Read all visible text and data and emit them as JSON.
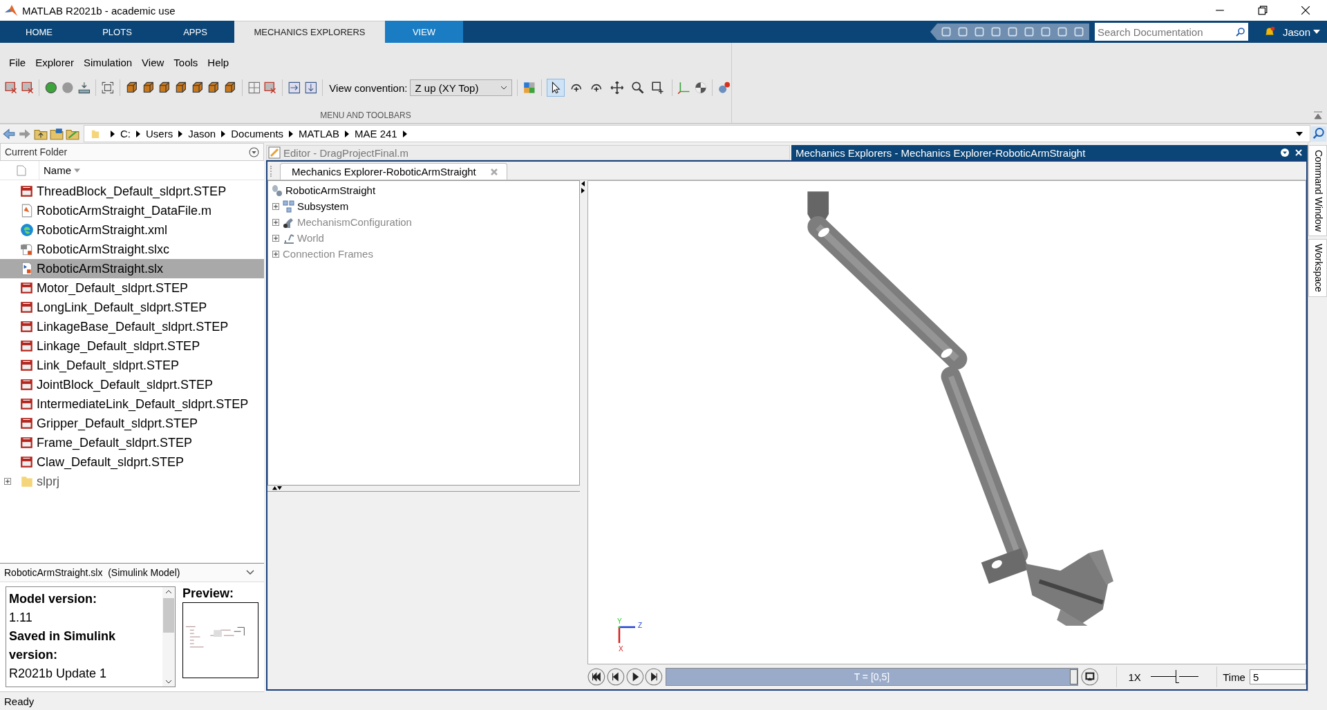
{
  "window": {
    "title": "MATLAB R2021b - academic use"
  },
  "ribbon_tabs": [
    {
      "label": "HOME",
      "selected": false,
      "kind": "standard"
    },
    {
      "label": "PLOTS",
      "selected": false,
      "kind": "standard"
    },
    {
      "label": "APPS",
      "selected": false,
      "kind": "standard"
    },
    {
      "label": "MECHANICS EXPLORERS",
      "selected": true,
      "kind": "standard"
    },
    {
      "label": "VIEW",
      "selected": false,
      "kind": "contextual"
    }
  ],
  "search": {
    "placeholder": "Search Documentation"
  },
  "user": "Jason",
  "menu": [
    "File",
    "Explorer",
    "Simulation",
    "View",
    "Tools",
    "Help"
  ],
  "view_convention": {
    "label": "View convention:",
    "value": "Z up (XY Top)"
  },
  "view_tools": [
    {
      "kind": "pointer",
      "selected": true
    },
    {
      "kind": "rotate",
      "selected": false
    },
    {
      "kind": "roll",
      "selected": false
    },
    {
      "kind": "pan",
      "selected": false
    },
    {
      "kind": "zoom",
      "selected": false
    },
    {
      "kind": "zoom-box",
      "selected": false
    }
  ],
  "toolstrip_section": "MENU AND TOOLBARS",
  "address": [
    "C:",
    "Users",
    "Jason",
    "Documents",
    "MATLAB",
    "MAE 241"
  ],
  "current_folder": {
    "title": "Current Folder",
    "column": "Name",
    "files": [
      {
        "name": "ThreadBlock_Default_sldprt.STEP",
        "kind": "step",
        "selected": false
      },
      {
        "name": "RoboticArmStraight_DataFile.m",
        "kind": "m",
        "selected": false
      },
      {
        "name": "RoboticArmStraight.xml",
        "kind": "xml",
        "selected": false
      },
      {
        "name": "RoboticArmStraight.slxc",
        "kind": "slxc",
        "selected": false
      },
      {
        "name": "RoboticArmStraight.slx",
        "kind": "slx",
        "selected": true
      },
      {
        "name": "Motor_Default_sldprt.STEP",
        "kind": "step",
        "selected": false
      },
      {
        "name": "LongLink_Default_sldprt.STEP",
        "kind": "step",
        "selected": false
      },
      {
        "name": "LinkageBase_Default_sldprt.STEP",
        "kind": "step",
        "selected": false
      },
      {
        "name": "Linkage_Default_sldprt.STEP",
        "kind": "step",
        "selected": false
      },
      {
        "name": "Link_Default_sldprt.STEP",
        "kind": "step",
        "selected": false
      },
      {
        "name": "JointBlock_Default_sldprt.STEP",
        "kind": "step",
        "selected": false
      },
      {
        "name": "IntermediateLink_Default_sldprt.STEP",
        "kind": "step",
        "selected": false
      },
      {
        "name": "Gripper_Default_sldprt.STEP",
        "kind": "step",
        "selected": false
      },
      {
        "name": "Frame_Default_sldprt.STEP",
        "kind": "step",
        "selected": false
      },
      {
        "name": "Claw_Default_sldprt.STEP",
        "kind": "step",
        "selected": false
      },
      {
        "name": "slprj",
        "kind": "folder",
        "selected": false
      }
    ]
  },
  "details": {
    "header": "RoboticArmStraight.slx  (Simulink Model)",
    "lines": [
      {
        "text": "Model version:",
        "bold": true
      },
      {
        "text": "1.11",
        "bold": false
      },
      {
        "text": "Saved in Simulink version:",
        "bold": true
      },
      {
        "text": "R2021b Update 1",
        "bold": false
      }
    ],
    "preview_label": "Preview:"
  },
  "status_bar": "Ready",
  "editor_tab": "Editor - DragProjectFinal.m",
  "explorer": {
    "title": "Mechanics Explorers - Mechanics Explorer-RoboticArmStraight",
    "tab": "Mechanics Explorer-RoboticArmStraight",
    "tree": {
      "label": "RoboticArmStraight",
      "children": [
        {
          "label": "Subsystem",
          "kind": "subsystem",
          "disabled": false,
          "expanded": false
        },
        {
          "label": "MechanismConfiguration",
          "kind": "mechanism",
          "disabled": true,
          "expanded": false
        },
        {
          "label": "World",
          "kind": "world",
          "disabled": true,
          "expanded": false
        },
        {
          "label": "Connection Frames",
          "kind": "frames",
          "disabled": true,
          "expanded": false
        }
      ]
    },
    "axes": {
      "y": "Y",
      "z": "Z",
      "x": "X"
    },
    "progress": {
      "label": "T = [0,5]",
      "level": 1
    },
    "speed": {
      "label": "1X",
      "level": 0.55
    },
    "time": {
      "label": "Time",
      "value": "5"
    }
  },
  "side_tabs": [
    "Command Window",
    "Workspace"
  ]
}
